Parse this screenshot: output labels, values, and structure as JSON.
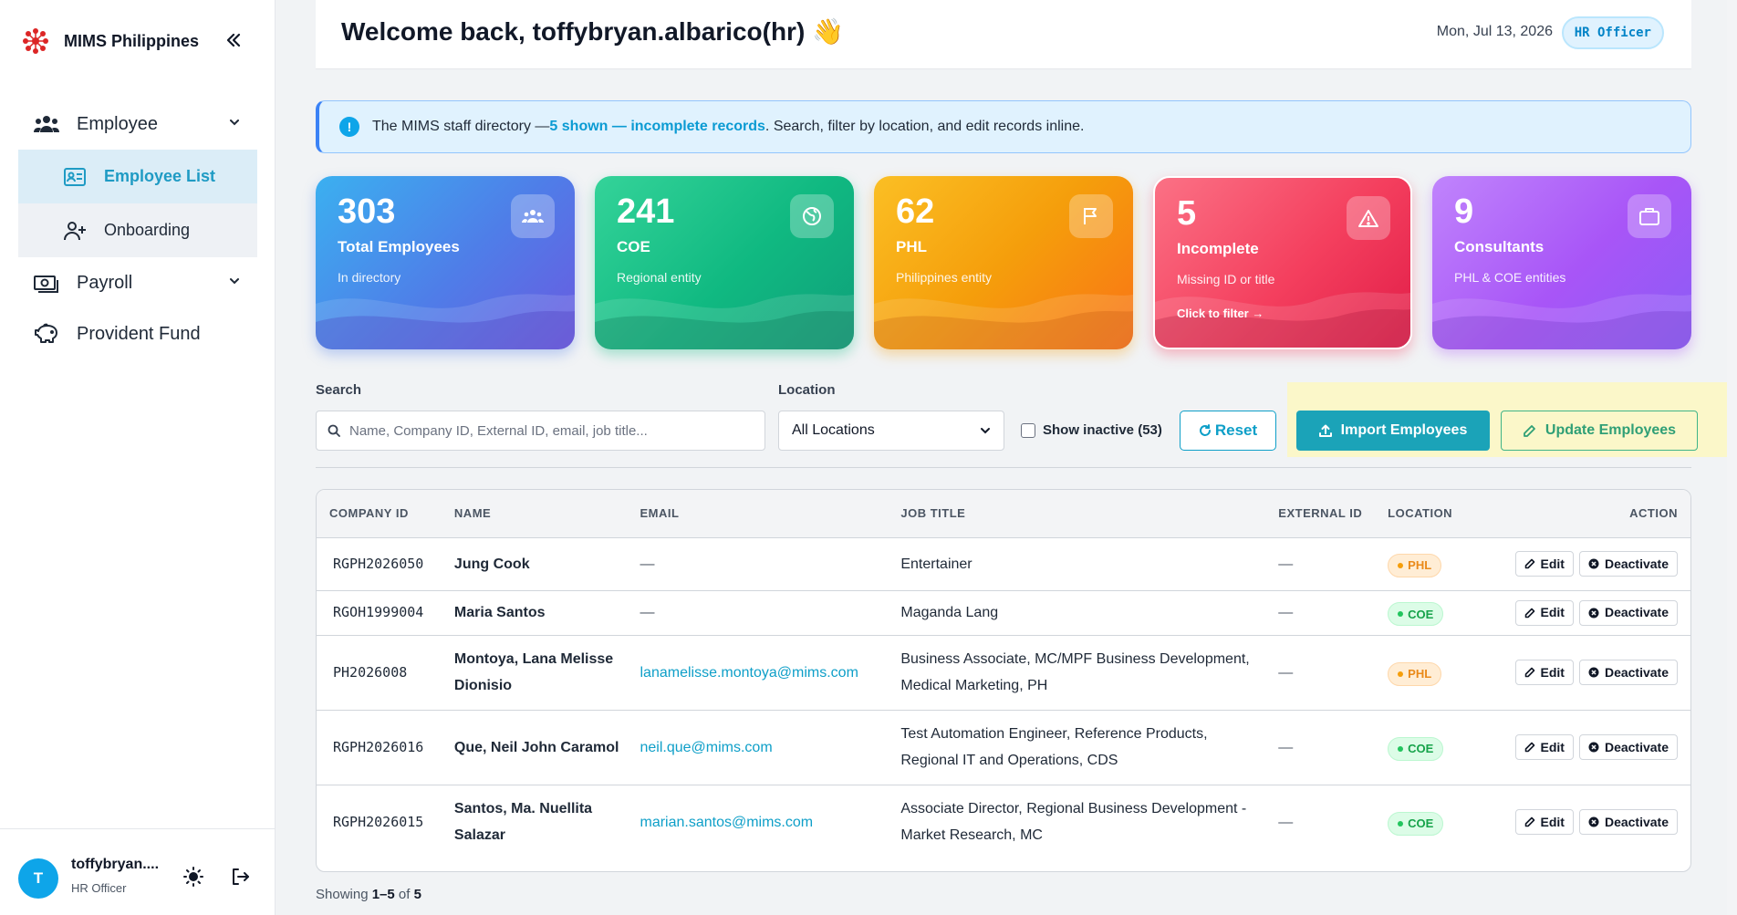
{
  "sidebar": {
    "brand": "MIMS Philippines",
    "nav": {
      "employee": "Employee",
      "employee_list": "Employee List",
      "onboarding": "Onboarding",
      "payroll": "Payroll",
      "provident_fund": "Provident Fund"
    },
    "user": {
      "initial": "T",
      "name": "toffybryan....",
      "role": "HR Officer"
    }
  },
  "header": {
    "welcome": "Welcome back, toffybryan.albarico(hr) 👋",
    "date": "Mon, Jul 13, 2026",
    "role_badge": "HR Officer"
  },
  "banner": {
    "prefix": "The MIMS staff directory — ",
    "highlight": "5 shown — incomplete records",
    "suffix": ". Search, filter by location, and edit records inline."
  },
  "cards": [
    {
      "value": "303",
      "title": "Total Employees",
      "sub": "In directory",
      "icon": "people-icon",
      "color": "blue"
    },
    {
      "value": "241",
      "title": "COE",
      "sub": "Regional entity",
      "icon": "globe-icon",
      "color": "green"
    },
    {
      "value": "62",
      "title": "PHL",
      "sub": "Philippines entity",
      "icon": "flag-icon",
      "color": "orange"
    },
    {
      "value": "5",
      "title": "Incomplete",
      "sub": "Missing ID or title",
      "link": "Click to filter →",
      "icon": "warning-icon",
      "color": "red"
    },
    {
      "value": "9",
      "title": "Consultants",
      "sub": "PHL & COE entities",
      "icon": "briefcase-icon",
      "color": "purple"
    }
  ],
  "filters": {
    "search_label": "Search",
    "search_placeholder": "Name, Company ID, External ID, email, job title...",
    "location_label": "Location",
    "location_value": "All Locations",
    "show_inactive": "Show inactive (53)",
    "reset": "Reset",
    "import": "Import Employees",
    "update": "Update Employees"
  },
  "table": {
    "headers": [
      "COMPANY ID",
      "NAME",
      "EMAIL",
      "JOB TITLE",
      "EXTERNAL ID",
      "LOCATION",
      "ACTION"
    ],
    "edit_label": "Edit",
    "deactivate_label": "Deactivate",
    "rows": [
      {
        "cid": "RGPH2026050",
        "name": "Jung Cook",
        "email": "—",
        "job": "Entertainer",
        "ext": "—",
        "loc": "PHL"
      },
      {
        "cid": "RGOH1999004",
        "name": "Maria Santos",
        "email": "—",
        "job": "Maganda Lang",
        "ext": "—",
        "loc": "COE"
      },
      {
        "cid": "PH2026008",
        "name": "Montoya, Lana Melisse Dionisio",
        "email": "lanamelisse.montoya@mims.com",
        "job": "Business Associate, MC/MPF Business Development, Medical Marketing, PH",
        "ext": "—",
        "loc": "PHL"
      },
      {
        "cid": "RGPH2026016",
        "name": "Que, Neil John Caramol",
        "email": "neil.que@mims.com",
        "job": "Test Automation Engineer, Reference Products, Regional IT and Operations, CDS",
        "ext": "—",
        "loc": "COE"
      },
      {
        "cid": "RGPH2026015",
        "name": "Santos, Ma. Nuellita Salazar",
        "email": "marian.santos@mims.com",
        "job": "Associate Director, Regional Business Development - Market Research, MC",
        "ext": "—",
        "loc": "COE"
      }
    ]
  },
  "footer": {
    "showing_prefix": "Showing ",
    "showing_range": "1–5",
    "showing_of": " of ",
    "showing_total": "5"
  },
  "colors": {
    "accent": "#1ba3b8",
    "link": "#0e9fc8",
    "phl": "#ea8a1a",
    "coe": "#16a34a"
  }
}
